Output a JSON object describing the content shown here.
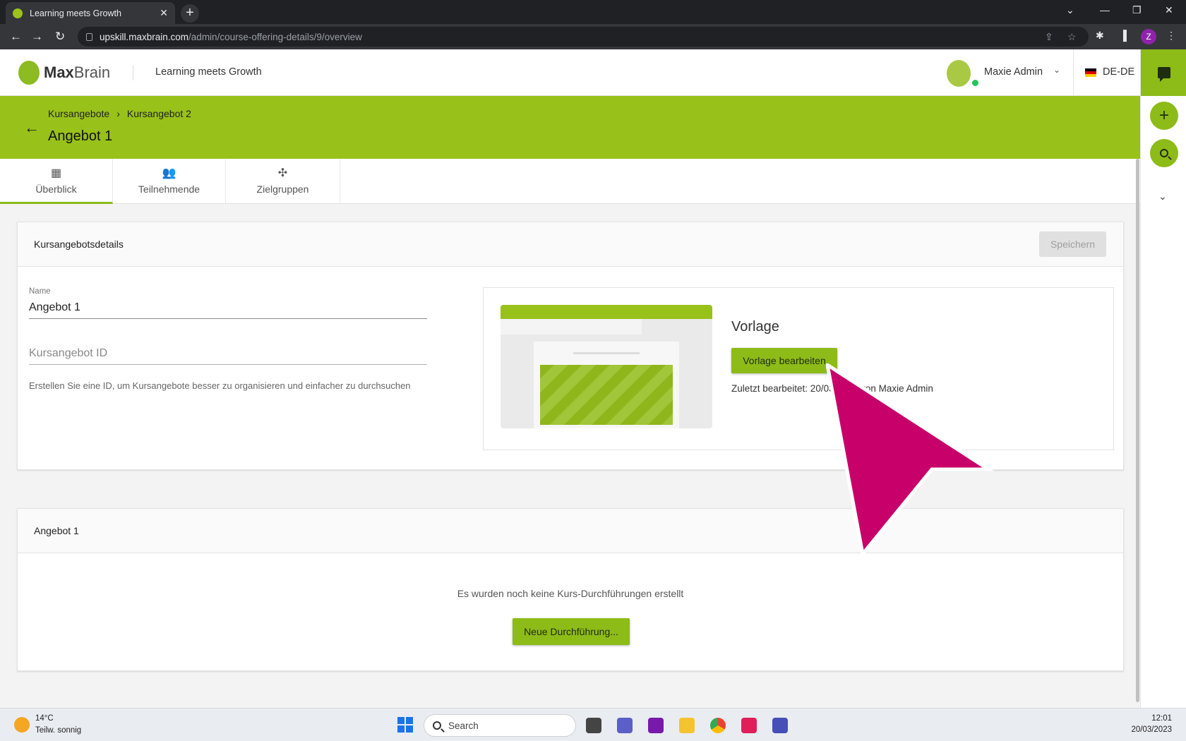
{
  "browser": {
    "tab_title": "Learning meets Growth",
    "url_host": "upskill.maxbrain.com",
    "url_path": "/admin/course-offering-details/9/overview",
    "profile_initial": "Z"
  },
  "header": {
    "logo_bold": "Max",
    "logo_light": "Brain",
    "slogan": "Learning meets Growth",
    "user_name": "Maxie Admin",
    "language": "DE-DE"
  },
  "page": {
    "breadcrumbs": [
      "Kursangebote",
      "Kursangebot 2"
    ],
    "title": "Angebot 1"
  },
  "tabs": [
    {
      "label": "Überblick",
      "icon": "dashboard-icon"
    },
    {
      "label": "Teilnehmende",
      "icon": "people-icon"
    },
    {
      "label": "Zielgruppen",
      "icon": "groups-icon"
    }
  ],
  "details_card": {
    "title": "Kursangebotsdetails",
    "save_label": "Speichern",
    "name_label": "Name",
    "name_value": "Angebot 1",
    "id_placeholder": "Kursangebot ID",
    "id_hint": "Erstellen Sie eine ID, um Kursangebote besser zu organisieren und einfacher zu durchsuchen",
    "template_title": "Vorlage",
    "template_button": "Vorlage bearbeiten",
    "last_edited": "Zuletzt bearbeitet: 20/03/2023 von Maxie Admin"
  },
  "runs_card": {
    "title": "Angebot 1",
    "empty_message": "Es wurden noch keine Kurs-Durchführungen erstellt",
    "new_button": "Neue Durchführung..."
  },
  "taskbar": {
    "temperature": "14°C",
    "weather": "Teilw. sonnig",
    "search_label": "Search",
    "time": "12:01",
    "date": "20/03/2023"
  },
  "colors": {
    "brand_green": "#98c11a",
    "cursor_magenta": "#c8006a"
  }
}
